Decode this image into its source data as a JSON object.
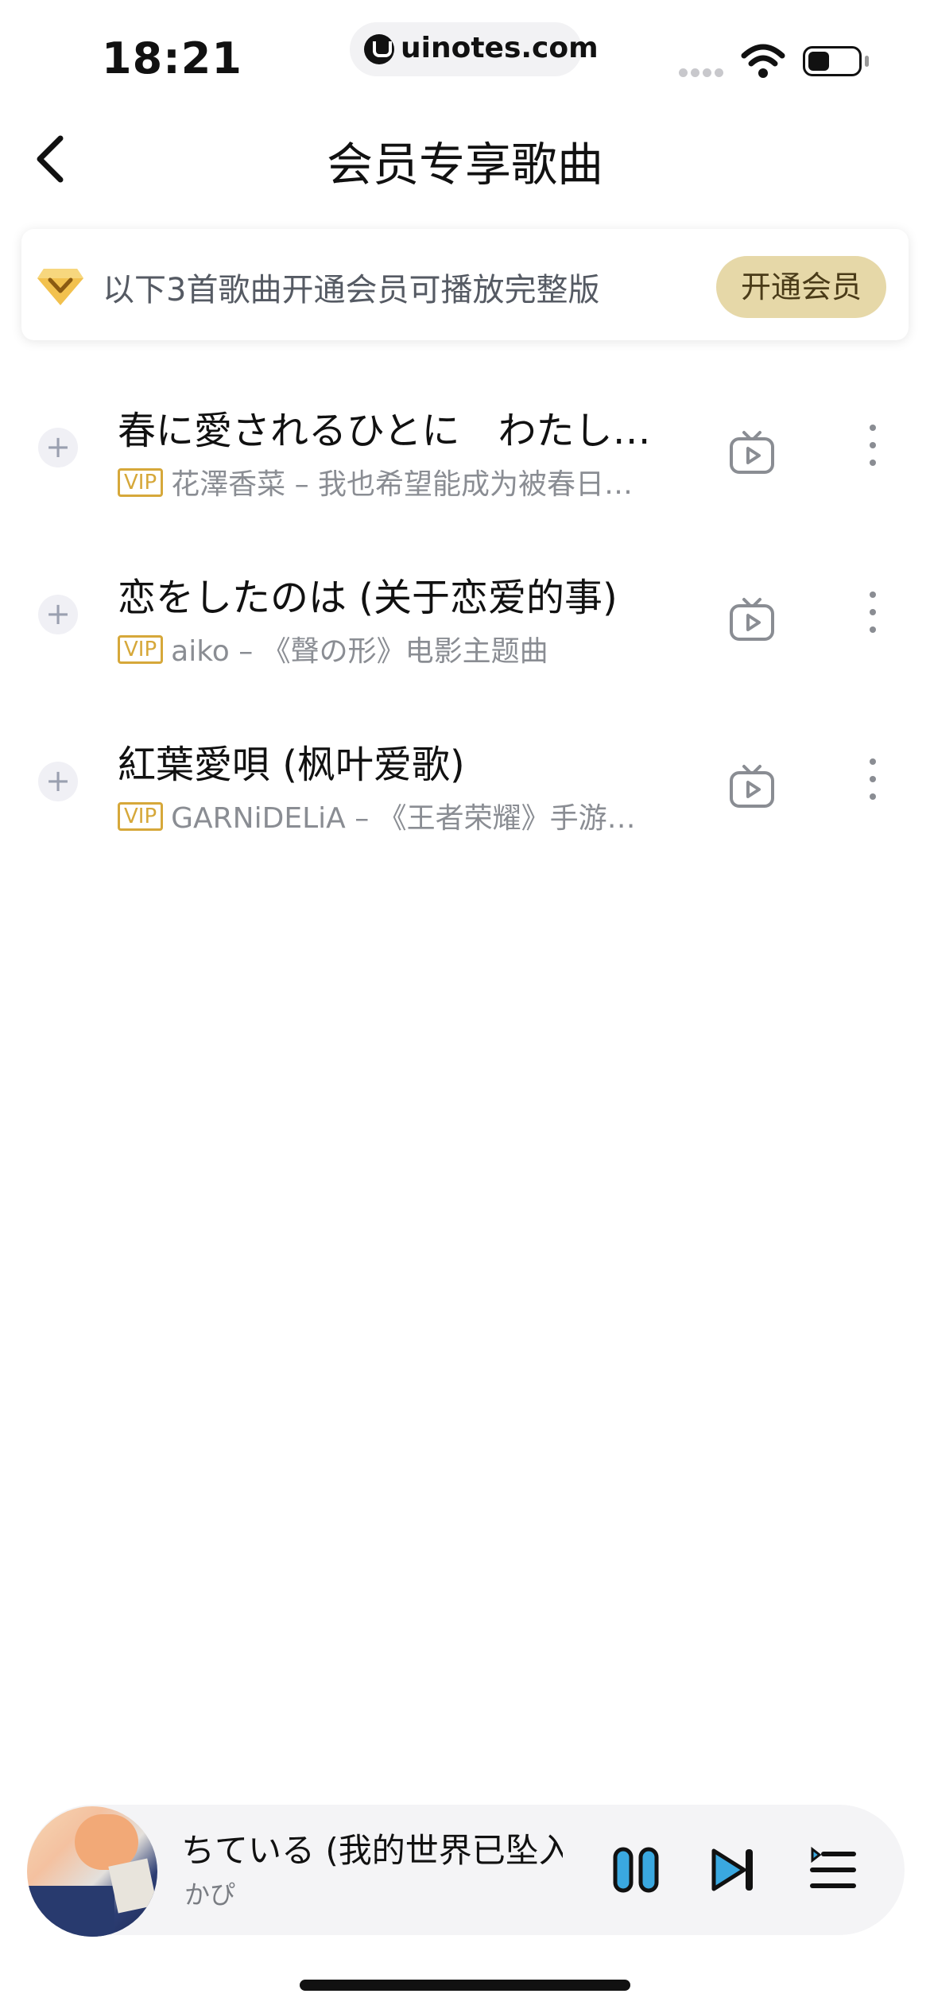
{
  "status_bar": {
    "time": "18:21",
    "url": "uinotes.com",
    "icons": [
      "signal-icon",
      "wifi-icon",
      "battery-icon"
    ]
  },
  "nav": {
    "back_icon": "chevron-left-icon",
    "title": "会员专享歌曲"
  },
  "banner": {
    "icon": "diamond-icon",
    "text": "以下3首歌曲开通会员可播放完整版",
    "button_label": "开通会员"
  },
  "songs": [
    {
      "title": "春に愛されるひとに　わたしは…",
      "badge": "VIP",
      "meta": "花澤香菜 – 我也希望能成为被春日所…"
    },
    {
      "title": "恋をしたのは (关于恋爱的事)",
      "badge": "VIP",
      "meta": "aiko – 《聲の形》电影主题曲"
    },
    {
      "title": "紅葉愛唄 (枫叶爱歌)",
      "badge": "VIP",
      "meta": "GARNiDELiA – 《王者荣耀》手游公…"
    }
  ],
  "player": {
    "title": "ちている (我的世界已坠入",
    "artist": "かぴ",
    "controls": [
      "pause-icon",
      "next-icon",
      "playlist-icon"
    ]
  },
  "colors": {
    "vip_gold": "#d6a83a",
    "button_gold_bg": "#e6d8a8",
    "player_accent": "#3aa8e0"
  }
}
